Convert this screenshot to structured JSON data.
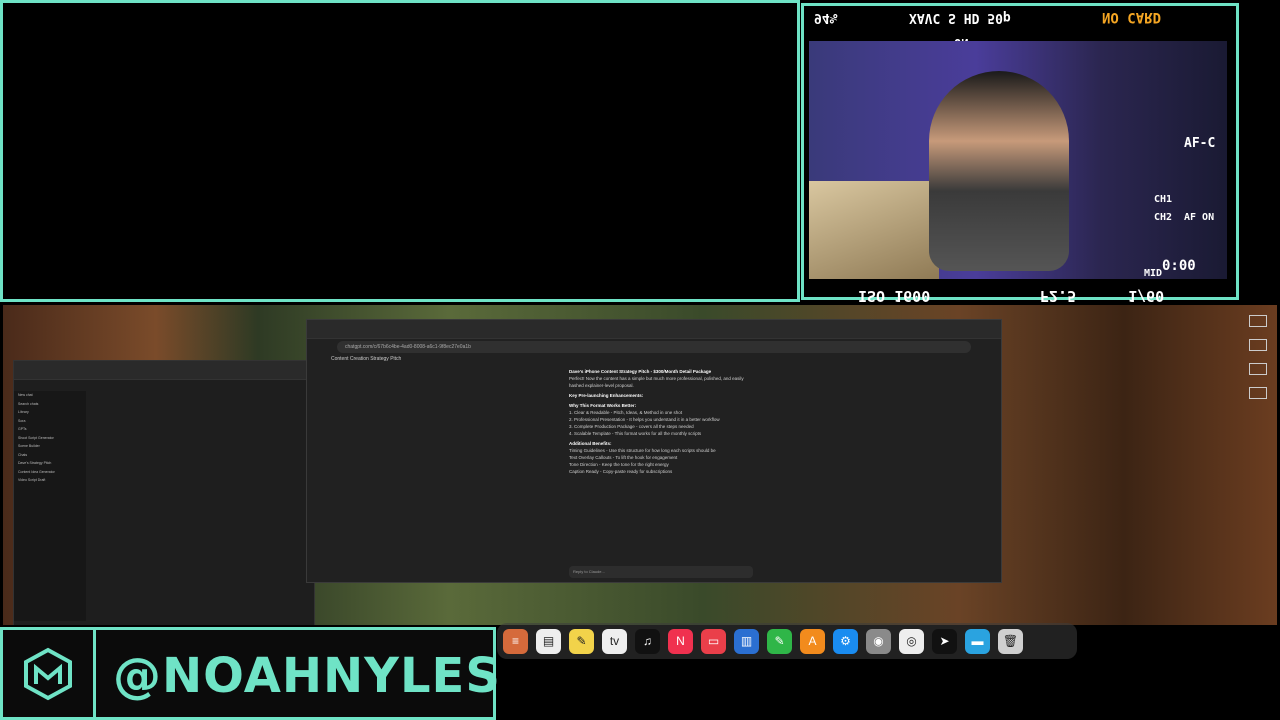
{
  "brand": {
    "handle": "@NOAHNYLES"
  },
  "camera_hud": {
    "top_left": "94%",
    "top_mid": "XAVC S HD 50p",
    "top_right": "NO CARD",
    "under": "ON",
    "af_mode": "AF-C",
    "ch1": "CH1",
    "ch2": "CH2",
    "af_on": "AF ON",
    "time": "0:00",
    "mid": "MID",
    "iso": "ISO 1600",
    "aperture": "F2.5",
    "shutter": "1/60"
  },
  "browser": {
    "url": "chatgpt.com/c/67b6c4be-4ad0-8008-a6c1-9f8ec27e0a1b",
    "title": "Content Creation Strategy Pitch",
    "doc_heading": "Dave's iPhone Content Strategy Pitch - $300/Month Detail Package",
    "intro": "Perfect! Now the content has a simple but much more professional, polished, and easily hashed explainer-level proposal.",
    "key_heading": "Key Pre-launching Enhancements:",
    "why_heading": "Why This Format Works Better:",
    "why_items": [
      "1. Clear & Readable - Pitch, Ideas, & Method in one shot",
      "2. Professional Presentation - It helps you understand it in a better workflow",
      "3. Complete Production Package - covers all the steps needed",
      "4. Scalable Template - This format works for all the monthly scripts"
    ],
    "additional_heading": "Additional Benefits:",
    "additional_items": [
      "Timing Guidelines - Use this structure for how long each scripts should be",
      "Text Overlay Callouts - To lift the hook for engagement",
      "Tone Direction - Keep the tone for the right energy",
      "Caption Ready - Copy-paste ready for subscriptions"
    ],
    "input_placeholder": "Reply to Claude..."
  },
  "sidebar": {
    "items": [
      "New chat",
      "Search chats",
      "Library",
      "Sora",
      "GPTs",
      "Shoot Script Generator",
      "Scene Builder",
      "Chats",
      "Dave's Strategy Pitch",
      "Content Idea Generator",
      "Video Script Draft"
    ]
  },
  "dock": {
    "icons": [
      "finder-icon",
      "notes-icon",
      "freeform-icon",
      "apple-tv-icon",
      "music-icon",
      "news-icon",
      "keynote-icon",
      "numbers-icon",
      "pages-icon",
      "app-store-icon",
      "settings-icon",
      "chrome-icon",
      "obs-icon",
      "telegram-icon",
      "desktop-icon",
      "trash-icon"
    ],
    "labels": [
      "≡",
      "▤",
      "✎",
      "tv",
      "♫",
      "N",
      "▭",
      "▥",
      "✎",
      "A",
      "⚙",
      "◉",
      "◎",
      "➤",
      "▬",
      "🗑"
    ],
    "colors": [
      "#d56a3b",
      "#eee",
      "#f2d34a",
      "#eee",
      "#111",
      "#f0314f",
      "#ea3f4a",
      "#2b6fd1",
      "#2fb648",
      "#f28b1d",
      "#1a8cf0",
      "#8a8a8a",
      "#eee",
      "#111",
      "#2aa3e0",
      "#cfcfcf"
    ]
  }
}
